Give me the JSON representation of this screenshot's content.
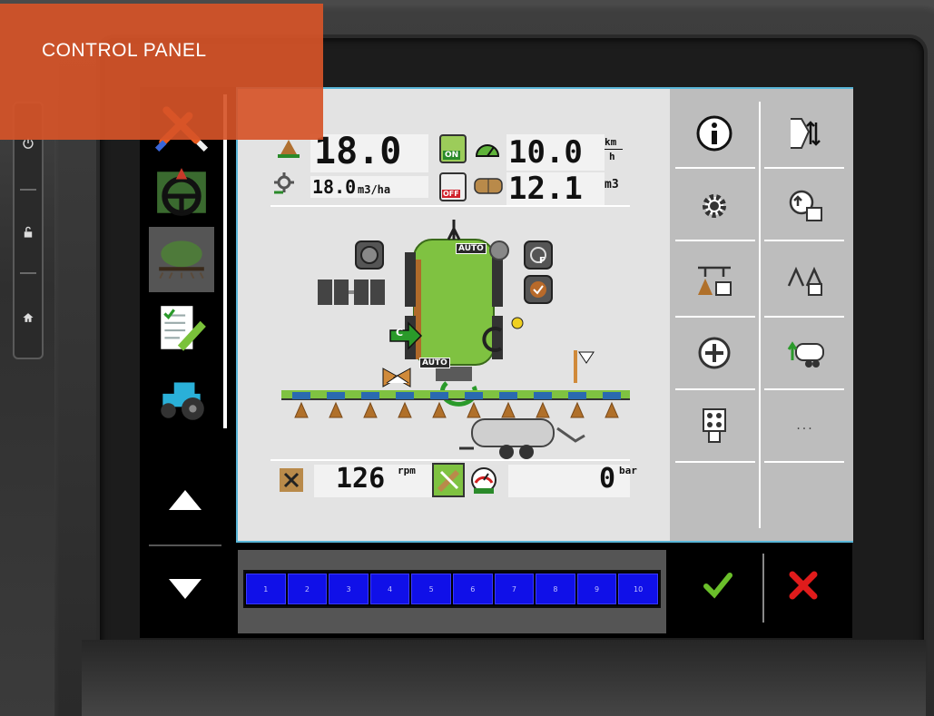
{
  "overlay": {
    "title": "CONTROL PANEL"
  },
  "colors": {
    "overlay": "#d65428",
    "tank_green": "#7fc241",
    "section_blue": "#1010e8",
    "ok_green": "#6abf2a",
    "cancel_red": "#e01b1b",
    "content_border": "#59b6d8"
  },
  "nav": {
    "items": [
      {
        "name": "settings-tools",
        "icon": "wrench-screwdriver-icon"
      },
      {
        "name": "guidance",
        "icon": "steering-wheel-icon"
      },
      {
        "name": "sprayer",
        "icon": "sprayer-icon"
      },
      {
        "name": "job-notes",
        "icon": "notepad-pencil-icon"
      },
      {
        "name": "tractor",
        "icon": "tractor-icon"
      }
    ],
    "active_index": 2
  },
  "readouts": {
    "application_rate": "18.0",
    "rate_setpoint": "18.0",
    "rate_setpoint_unit": "m3/ha",
    "speed": "10.0",
    "speed_unit_top": "km",
    "speed_unit_bottom": "h",
    "tank_volume": "12.1",
    "tank_volume_unit": "m3",
    "pump_speed": "126",
    "pump_speed_unit": "rpm",
    "pressure": "0",
    "pressure_unit": "bar"
  },
  "badges": {
    "on": "ON",
    "off": "OFF",
    "auto_top": "AUTO",
    "auto_valve": "AUTO",
    "c_label": "C",
    "f_label": "F"
  },
  "right_panel": {
    "buttons": [
      {
        "name": "info",
        "icon": "info-icon"
      },
      {
        "name": "hitch-adjust",
        "icon": "hitch-arrows-icon"
      },
      {
        "name": "settings",
        "icon": "gear-icon"
      },
      {
        "name": "calibration",
        "icon": "calibration-icon"
      },
      {
        "name": "section-config",
        "icon": "section-config-icon"
      },
      {
        "name": "boom-fold",
        "icon": "boom-fold-icon"
      },
      {
        "name": "add",
        "icon": "plus-circle-icon"
      },
      {
        "name": "tank-fill",
        "icon": "tank-fill-icon"
      },
      {
        "name": "joystick",
        "icon": "joystick-icon"
      },
      {
        "name": "more",
        "label": "..."
      }
    ]
  },
  "sections": {
    "labels": [
      "1",
      "2",
      "3",
      "4",
      "5",
      "6",
      "7",
      "8",
      "9",
      "10"
    ]
  }
}
